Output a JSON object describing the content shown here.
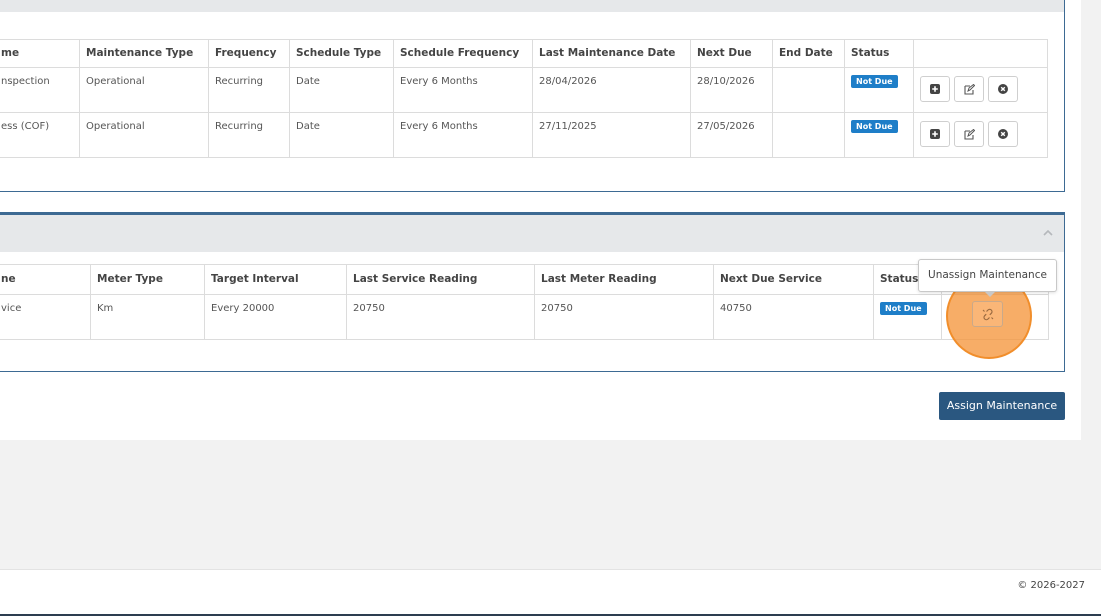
{
  "schedule_table": {
    "headers": [
      "me",
      "Maintenance Type",
      "Frequency",
      "Schedule Type",
      "Schedule Frequency",
      "Last Maintenance Date",
      "Next Due",
      "End Date",
      "Status",
      ""
    ],
    "rows": [
      [
        "nspection",
        "Operational",
        "Recurring",
        "Date",
        "Every 6 Months",
        "28/04/2026",
        "28/10/2026",
        "",
        "Not Due"
      ],
      [
        "ess (COF)",
        "Operational",
        "Recurring",
        "Date",
        "Every 6 Months",
        "27/11/2025",
        "27/05/2026",
        "",
        "Not Due"
      ]
    ]
  },
  "meter_table": {
    "headers": [
      "ne",
      "Meter Type",
      "Target Interval",
      "Last Service Reading",
      "Last Meter Reading",
      "Next Due Service",
      "Status",
      ""
    ],
    "rows": [
      [
        "vice",
        "Km",
        "Every 20000",
        "20750",
        "20750",
        "40750",
        "Not Due"
      ]
    ]
  },
  "tooltip": "Unassign Maintenance",
  "assign_button": "Assign Maintenance",
  "footer": "© 2026-2027",
  "icons": {
    "add": "plus-square-icon",
    "edit": "edit-icon",
    "remove": "close-circle-icon",
    "unlink": "unlink-icon",
    "collapse": "chevron-up-icon"
  },
  "colors": {
    "primary": "#2a5780",
    "badge": "#1e7ec8",
    "panel_border": "#3d6a93",
    "highlight": "#f5963c"
  }
}
